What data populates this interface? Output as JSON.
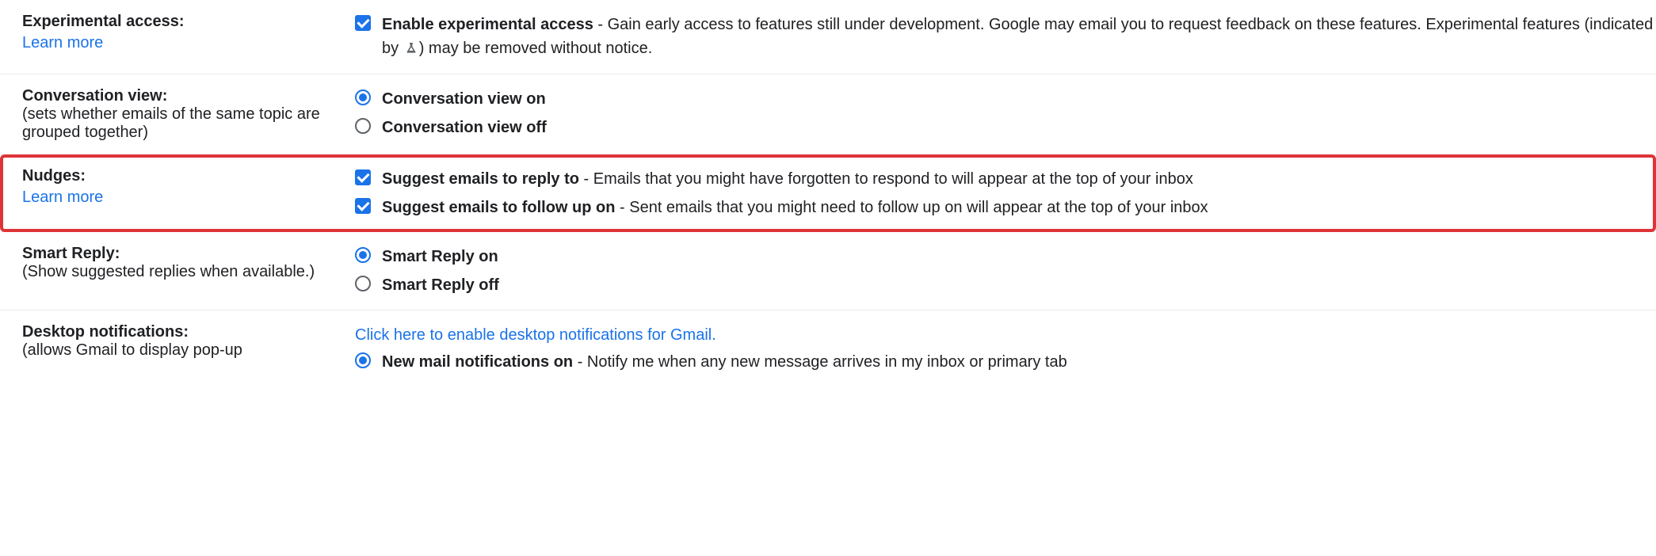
{
  "experimental": {
    "title": "Experimental access:",
    "learn_more": "Learn more",
    "option_label": "Enable experimental access",
    "desc_part1": " - Gain early access to features still under development. Google may email you to request feedback on these features. Experimental features (indicated by ",
    "desc_part2": ") may be removed without notice."
  },
  "conversation": {
    "title": "Conversation view:",
    "sub": "(sets whether emails of the same topic are grouped together)",
    "on": "Conversation view on",
    "off": "Conversation view off"
  },
  "nudges": {
    "title": "Nudges:",
    "learn_more": "Learn more",
    "reply_label": "Suggest emails to reply to",
    "reply_desc": " - Emails that you might have forgotten to respond to will appear at the top of your inbox",
    "follow_label": "Suggest emails to follow up on",
    "follow_desc": " - Sent emails that you might need to follow up on will appear at the top of your inbox"
  },
  "smartreply": {
    "title": "Smart Reply:",
    "sub": "(Show suggested replies when available.)",
    "on": "Smart Reply on",
    "off": "Smart Reply off"
  },
  "desktop": {
    "title": "Desktop notifications:",
    "sub": "(allows Gmail to display pop-up",
    "enable_link": "Click here to enable desktop notifications for Gmail.",
    "new_label": "New mail notifications on",
    "new_desc": " - Notify me when any new message arrives in my inbox or primary tab"
  }
}
